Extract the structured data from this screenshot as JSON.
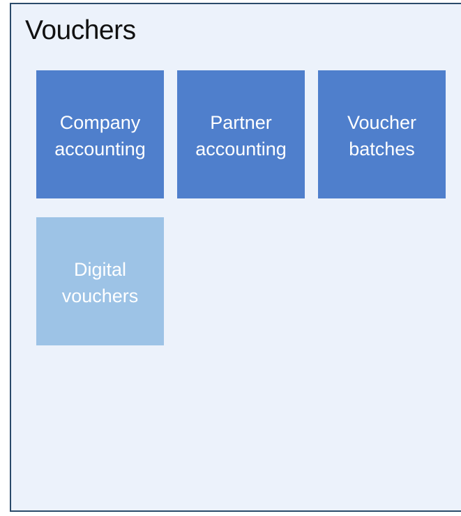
{
  "page": {
    "title": "Vouchers"
  },
  "tiles": [
    {
      "label": "Company\naccounting",
      "style": "dark",
      "color": "#4f7fcc"
    },
    {
      "label": "Partner\naccounting",
      "style": "dark",
      "color": "#4f7fcc"
    },
    {
      "label": "Voucher\nbatches",
      "style": "dark",
      "color": "#4f7fcc"
    },
    {
      "label": "Digital\nvouchers",
      "style": "light",
      "color": "#9dc3e6"
    }
  ],
  "colors": {
    "panel_background": "#ecf2fb",
    "panel_border": "#2a4a6a"
  }
}
